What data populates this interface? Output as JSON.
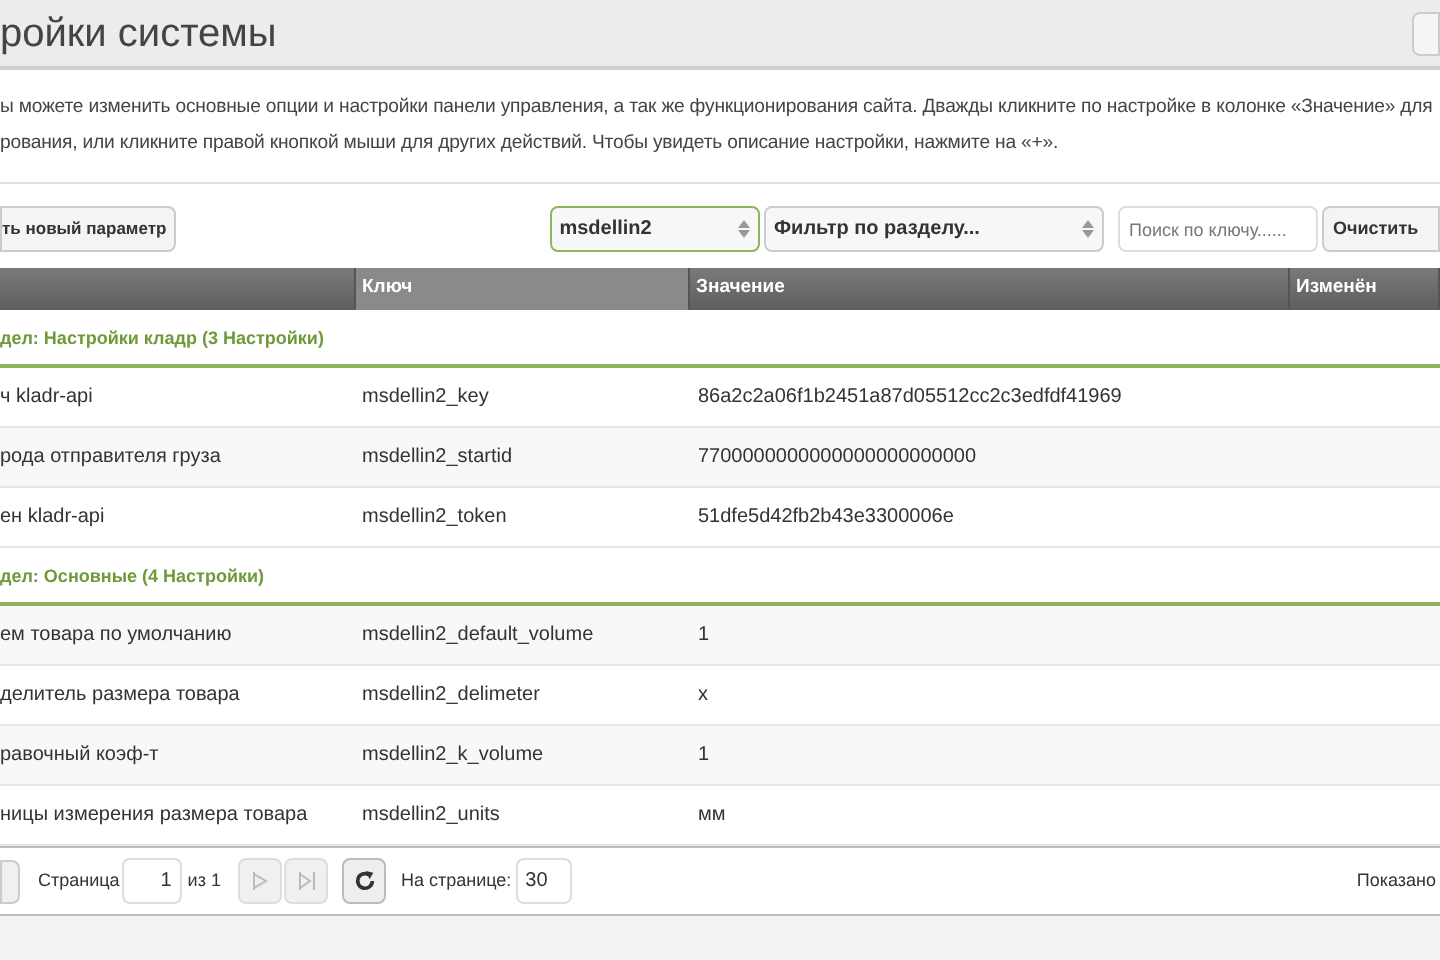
{
  "header": {
    "title": "ройки системы"
  },
  "description": [
    "ы можете изменить основные опции и настройки панели управления, а так же функционирования сайта. Дважды кликните по настройке в колонке «Значение» для",
    "рования, или кликните правой кнопкой мыши для других действий. Чтобы увидеть описание настройки, нажмите на «+»."
  ],
  "toolbar": {
    "add_button": "ть новый параметр",
    "namespace_select": {
      "value": "msdellin2",
      "focused": true
    },
    "area_select": {
      "value": "Фильтр по разделу..."
    },
    "search": {
      "placeholder": "Поиск по ключу......"
    },
    "clear_button": "Очистить"
  },
  "table": {
    "columns": [
      "",
      "Ключ",
      "Значение",
      "Изменён"
    ],
    "groups": [
      {
        "title": "дел: Настройки кладр (3 Настройки)",
        "rows": [
          {
            "name": "ч kladr-api",
            "key": "msdellin2_key",
            "value": "86a2c2a06f1b2451a87d05512cc2c3edfdf41969"
          },
          {
            "name": "рода отправителя груза",
            "key": "msdellin2_startid",
            "value": "7700000000000000000000000"
          },
          {
            "name": "ен kladr-api",
            "key": "msdellin2_token",
            "value": "51dfe5d42fb2b43e3300006e"
          }
        ]
      },
      {
        "title": "дел: Основные (4 Настройки)",
        "rows": [
          {
            "name": "ем товара по умолчанию",
            "key": "msdellin2_default_volume",
            "value": "1"
          },
          {
            "name": "делитель размера товара",
            "key": "msdellin2_delimeter",
            "value": "x"
          },
          {
            "name": "равочный коэф-т",
            "key": "msdellin2_k_volume",
            "value": "1"
          },
          {
            "name": "ницы измерения размера товара",
            "key": "msdellin2_units",
            "value": "мм"
          }
        ]
      }
    ]
  },
  "pagination": {
    "page_label": "Страница",
    "page": "1",
    "of": "из 1",
    "next_disabled": true,
    "per_page_label": "На странице:",
    "per_page": "30",
    "shown": "Показано"
  }
}
